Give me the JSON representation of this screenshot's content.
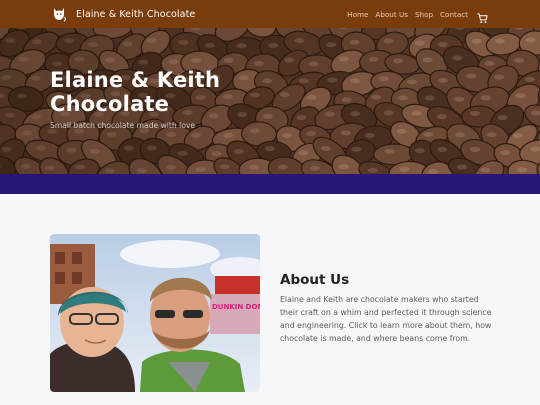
{
  "nav": {
    "brand": "Elaine & Keith Chocolate",
    "brand_icon": "cat-logo-icon",
    "links": [
      "Home",
      "About Us",
      "Shop",
      "Contact"
    ],
    "cart_icon": "cart-icon"
  },
  "hero": {
    "title": "Elaine & Keith Chocolate",
    "subtitle": "Small batch chocolate made with love"
  },
  "about": {
    "title": "About Us",
    "body": "Elaine and Keith are chocolate makers who started their craft on a whim and perfected it through science and engineering. Click to learn more about them, how chocolate is made, and where beans come from.",
    "photo_sign_text": "DUNKIN DONUTS"
  },
  "colors": {
    "navbar": "#7a3c0a",
    "accent_band": "#2a1578",
    "page_bg": "#f7f7fa"
  }
}
